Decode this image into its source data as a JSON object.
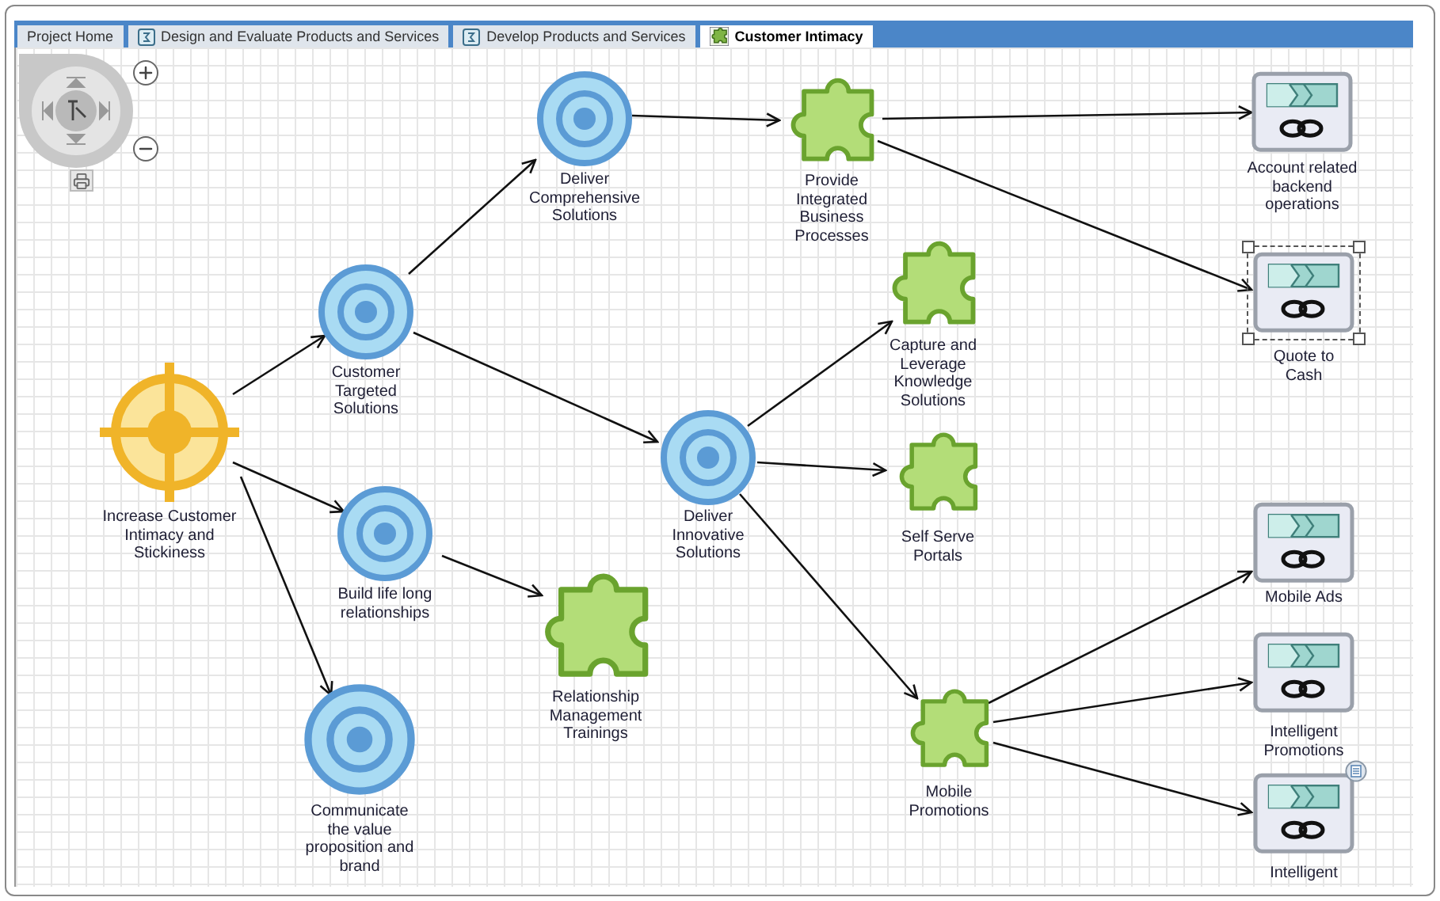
{
  "tabs": [
    {
      "label": "Project Home",
      "kind": "plain",
      "selected": false
    },
    {
      "label": "Design and Evaluate Products and Services",
      "kind": "process",
      "selected": false
    },
    {
      "label": "Develop Products and Services",
      "kind": "process",
      "selected": false
    },
    {
      "label": "Customer Intimacy",
      "kind": "puzzle",
      "selected": true
    }
  ],
  "diagram": {
    "nodes": [
      {
        "kind": "goal",
        "label": "Increase Customer Intimacy and Stickiness",
        "selected": false,
        "note": false
      },
      {
        "kind": "target",
        "label": "Customer Targeted Solutions",
        "selected": false,
        "note": false
      },
      {
        "kind": "target",
        "label": "Deliver Comprehensive Solutions",
        "selected": false,
        "note": false
      },
      {
        "kind": "target",
        "label": "Build life long relationships",
        "selected": false,
        "note": false
      },
      {
        "kind": "target",
        "label": "Communicate the value proposition and brand",
        "selected": false,
        "note": false
      },
      {
        "kind": "target",
        "label": "Deliver Innovative Solutions",
        "selected": false,
        "note": false
      },
      {
        "kind": "capability",
        "label": "Provide Integrated Business Processes",
        "selected": false,
        "note": false
      },
      {
        "kind": "capability",
        "label": "Relationship Management Trainings",
        "selected": false,
        "note": false
      },
      {
        "kind": "capability",
        "label": "Capture and Leverage Knowledge Solutions",
        "selected": false,
        "note": false
      },
      {
        "kind": "capability",
        "label": "Self Serve Portals",
        "selected": false,
        "note": false
      },
      {
        "kind": "capability",
        "label": "Mobile Promotions",
        "selected": false,
        "note": false
      },
      {
        "kind": "process",
        "label": "Account related backend operations",
        "selected": false,
        "note": false
      },
      {
        "kind": "process",
        "label": "Quote to Cash",
        "selected": true,
        "note": false
      },
      {
        "kind": "process",
        "label": "Mobile Ads",
        "selected": false,
        "note": false
      },
      {
        "kind": "process",
        "label": "Intelligent Promotions",
        "selected": false,
        "note": false
      },
      {
        "kind": "process",
        "label": "Intelligent",
        "selected": false,
        "note": true
      }
    ]
  }
}
